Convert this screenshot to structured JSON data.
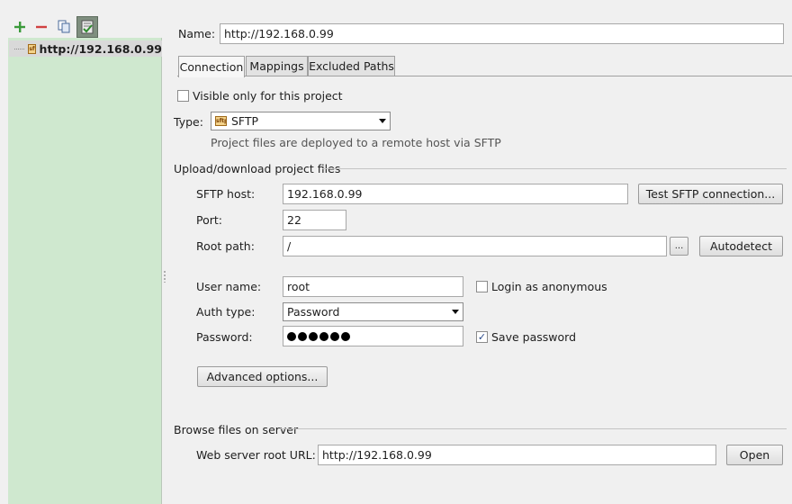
{
  "toolbar": {
    "add_icon": "plus-icon",
    "remove_icon": "minus-icon",
    "copy_icon": "copy-icon",
    "default_icon": "check-default-icon"
  },
  "servers": [
    {
      "label": "http://192.168.0.99",
      "icon": "sftp-icon"
    }
  ],
  "name": {
    "label": "Name:",
    "value": "http://192.168.0.99"
  },
  "tabs": [
    {
      "label": "Connection",
      "active": true
    },
    {
      "label": "Mappings",
      "active": false
    },
    {
      "label": "Excluded Paths",
      "active": false
    }
  ],
  "visible_only": {
    "label": "Visible only for this project",
    "checked": false
  },
  "type": {
    "label": "Type:",
    "value": "SFTP",
    "hint": "Project files are deployed to a remote host via SFTP"
  },
  "upload_section": {
    "title": "Upload/download project files",
    "host_label": "SFTP host:",
    "host_value": "192.168.0.99",
    "test_button": "Test SFTP connection...",
    "port_label": "Port:",
    "port_value": "22",
    "root_label": "Root path:",
    "root_value": "/",
    "browse_button": "...",
    "autodetect_button": "Autodetect",
    "user_label": "User name:",
    "user_value": "root",
    "anonymous_label": "Login as anonymous",
    "anonymous_checked": false,
    "auth_label": "Auth type:",
    "auth_value": "Password",
    "password_label": "Password:",
    "password_length": 6,
    "save_password_label": "Save password",
    "save_password_checked": true,
    "advanced_button": "Advanced options..."
  },
  "browse_section": {
    "title": "Browse files on server",
    "url_label": "Web server root URL:",
    "url_value": "http://192.168.0.99",
    "open_button": "Open"
  }
}
